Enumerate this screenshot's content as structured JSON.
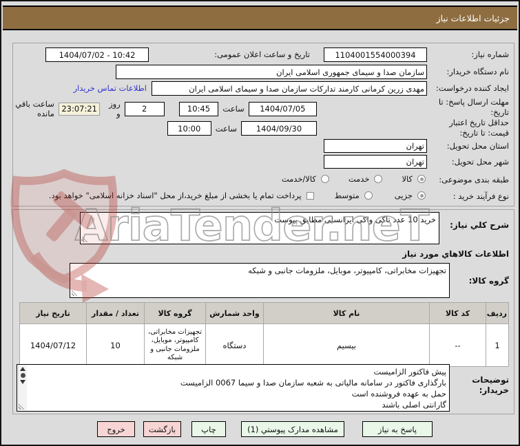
{
  "title": "جزئیات اطلاعات نیاز",
  "watermark_text": "AriaTender.neT",
  "colors": {
    "header_bar": "#8E6D40",
    "countdown_bg": "#F5F1DA",
    "button_green": "#E9F7E9",
    "button_pink": "#F8D5D5",
    "link_blue": "#3333CC",
    "watermark_red": "#C0392B"
  },
  "form": {
    "need_number_label": "شماره نیاز:",
    "need_number": "1104001554000394",
    "announce_label": "تاریخ و ساعت اعلان عمومی:",
    "announce_value": "1404/07/02 - 10:42",
    "buyer_org_label": "نام دستگاه خریدار:",
    "buyer_org": "سازمان صدا و سیمای جمهوری اسلامی ایران",
    "requester_label": "ایجاد کننده درخواست:",
    "requester": "مهدی زرین کرمانی کارمند تدارکات سازمان صدا و سیمای اسلامی ایران",
    "contact_link": "اطلاعات تماس خریدار",
    "deadline_label": "مهلت ارسال پاسخ: تا تاریخ:",
    "deadline_date": "1404/07/05",
    "hour_label": "ساعت",
    "deadline_time": "10:45",
    "days_value": "2",
    "days_label": "روز و",
    "countdown": "23:07:21",
    "remaining_label": "ساعت باقي مانده",
    "validity_label": "حداقل تاریخ اعتبار قیمت: تا تاریخ:",
    "validity_date": "1404/09/30",
    "validity_time": "10:00",
    "province_label": "استان محل تحویل:",
    "province": "تهران",
    "city_label": "شهر محل تحویل:",
    "city": "تهران",
    "category_label": "طبقه بندی موضوعی:",
    "category_options": [
      {
        "label": "کالا",
        "selected": true
      },
      {
        "label": "خدمت",
        "selected": false
      },
      {
        "label": "کالا/خدمت",
        "selected": false
      }
    ],
    "process_label": "نوع فرآیند خرید :",
    "process_options": [
      {
        "label": "جزیی",
        "selected": true
      },
      {
        "label": "متوسط",
        "selected": false
      }
    ],
    "treasury_checkbox_label": "پرداخت تمام یا بخشی از مبلغ خرید،از محل \"اسناد خزانه اسلامی\" خواهد بود.",
    "treasury_checked": false
  },
  "need_desc": {
    "label": "شرح کلي نیاز:",
    "value": "خرید 10 عدد تاکی واکی ایرانسلی مطابق پیوست"
  },
  "goods_section": {
    "heading": "اطلاعات کالاهاي مورد نیاز",
    "group_label": "گروه کالا:",
    "group_value": "تجهیزات مخابراتی، کامپیوتر، موبایل، ملزومات جانبی و شبکه",
    "table": {
      "headers": [
        "ردیف",
        "کد کالا",
        "نام کالا",
        "واحد شمارش",
        "گروه کالا",
        "تعداد / مقدار",
        "تاریخ نیاز"
      ],
      "rows": [
        [
          "1",
          "--",
          "بیسیم",
          "دستگاه",
          "تجهیزات مخابراتی، کامپیوتر، موبایل، ملزومات جانبی و شبکه",
          "10",
          "1404/07/12"
        ]
      ]
    },
    "buyer_notes_label": "توضیحات خریدار:",
    "buyer_notes_lines": [
      "پیش فاکتور الزامیست",
      "بارگذاری فاکتور در سامانه مالیاتی به شعبه سازمان صدا و سیما 0067 الزامیست",
      "حمل به عهده فروشنده است",
      "گارانتی اصلی باشند"
    ]
  },
  "buttons": [
    "پاسخ به نیاز",
    "مشاهده مدارک پیوستي (1)",
    "چاپ",
    "بازگشت",
    "خروج"
  ]
}
